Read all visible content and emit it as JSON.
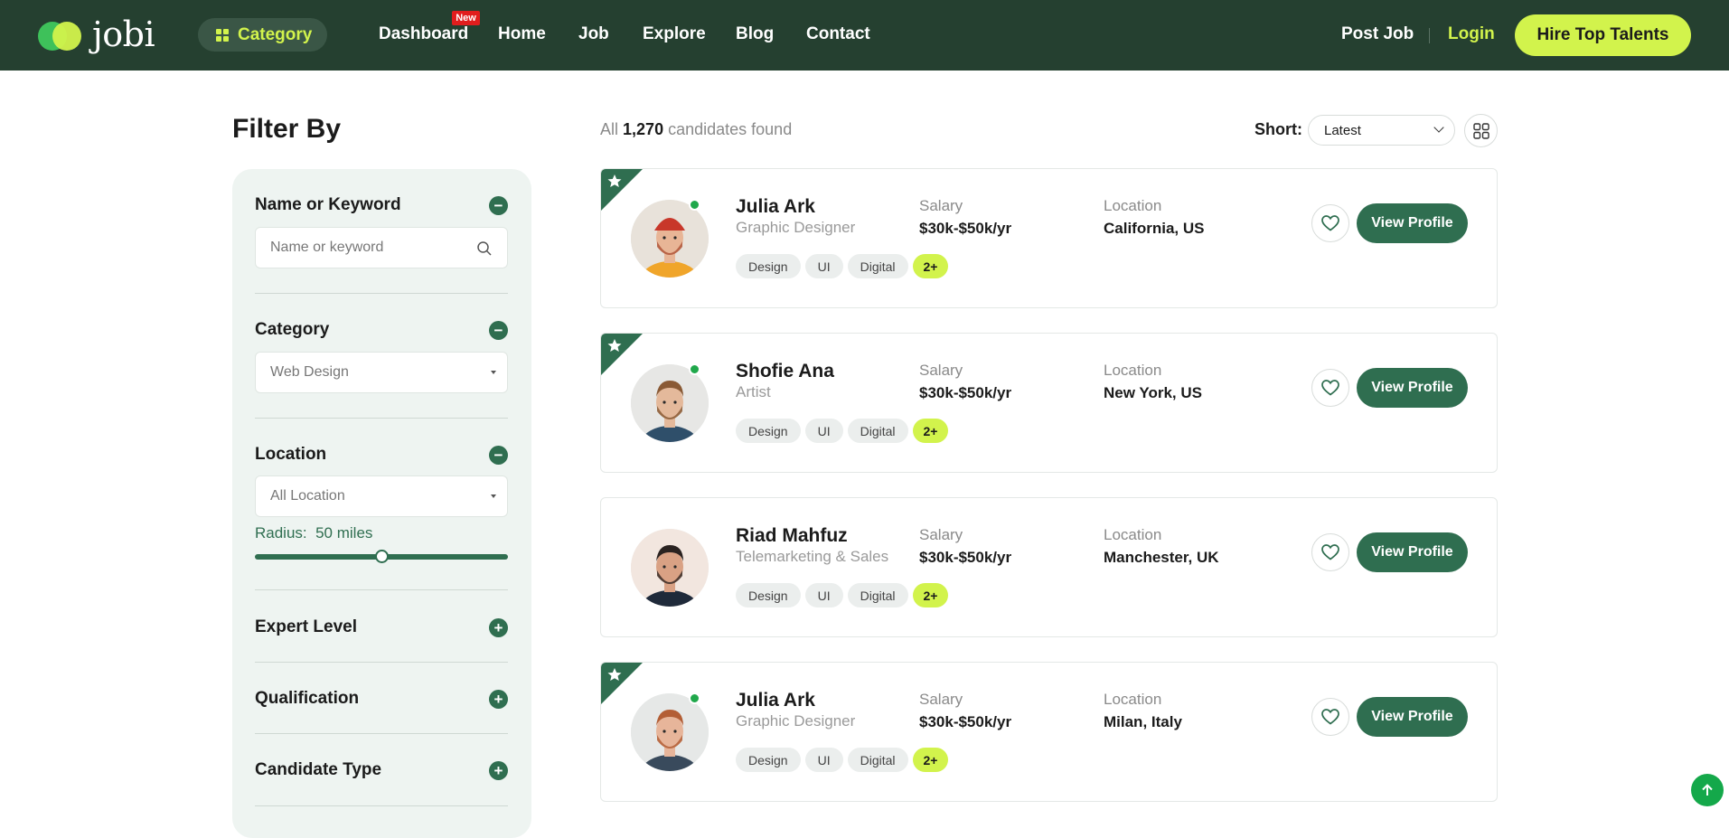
{
  "header": {
    "logo_text": "jobi",
    "category_label": "Category",
    "nav": [
      {
        "label": "Dashboard",
        "badge": "New"
      },
      {
        "label": "Home"
      },
      {
        "label": "Job"
      },
      {
        "label": "Explore"
      },
      {
        "label": "Blog"
      },
      {
        "label": "Contact"
      }
    ],
    "post_job": "Post Job",
    "login": "Login",
    "cta": "Hire Top Talents"
  },
  "filters": {
    "title": "Filter By",
    "keyword": {
      "title": "Name or Keyword",
      "placeholder": "Name or keyword",
      "toggle": "−"
    },
    "category": {
      "title": "Category",
      "selected": "Web Design",
      "toggle": "−"
    },
    "location": {
      "title": "Location",
      "selected": "All Location",
      "toggle": "−",
      "radius_label": "Radius:",
      "radius_value": "50 miles",
      "radius_fraction": 0.5
    },
    "collapsed": [
      {
        "title": "Expert Level",
        "toggle": "+"
      },
      {
        "title": "Qualification",
        "toggle": "+"
      },
      {
        "title": "Candidate Type",
        "toggle": "+"
      }
    ]
  },
  "results": {
    "prefix": "All",
    "count": "1,270",
    "suffix": "candidates found",
    "sort_label": "Short:",
    "sort_value": "Latest"
  },
  "candidates": [
    {
      "name": "Julia Ark",
      "role": "Graphic Designer",
      "tags": [
        "Design",
        "UI",
        "Digital",
        "2+"
      ],
      "salary_label": "Salary",
      "salary": "$30k-$50k/yr",
      "location_label": "Location",
      "location": "California, US",
      "featured": true,
      "online": true,
      "button": "View Profile",
      "avatar": "red-beanie-man"
    },
    {
      "name": "Shofie Ana",
      "role": "Artist",
      "tags": [
        "Design",
        "UI",
        "Digital",
        "2+"
      ],
      "salary_label": "Salary",
      "salary": "$30k-$50k/yr",
      "location_label": "Location",
      "location": "New York, US",
      "featured": true,
      "online": true,
      "button": "View Profile",
      "avatar": "bearded-man"
    },
    {
      "name": "Riad Mahfuz",
      "role": "Telemarketing & Sales",
      "tags": [
        "Design",
        "UI",
        "Digital",
        "2+"
      ],
      "salary_label": "Salary",
      "salary": "$30k-$50k/yr",
      "location_label": "Location",
      "location": "Manchester, UK",
      "featured": false,
      "online": false,
      "button": "View Profile",
      "avatar": "dark-hair-man"
    },
    {
      "name": "Julia Ark",
      "role": "Graphic Designer",
      "tags": [
        "Design",
        "UI",
        "Digital",
        "2+"
      ],
      "salary_label": "Salary",
      "salary": "$30k-$50k/yr",
      "location_label": "Location",
      "location": "Milan, Italy",
      "featured": true,
      "online": true,
      "button": "View Profile",
      "avatar": "red-beard-man"
    }
  ],
  "colors": {
    "header_bg": "#254030",
    "accent": "#d2f34c",
    "primary": "#2f6e50",
    "online": "#20a84b",
    "badge": "#e11d1d"
  }
}
